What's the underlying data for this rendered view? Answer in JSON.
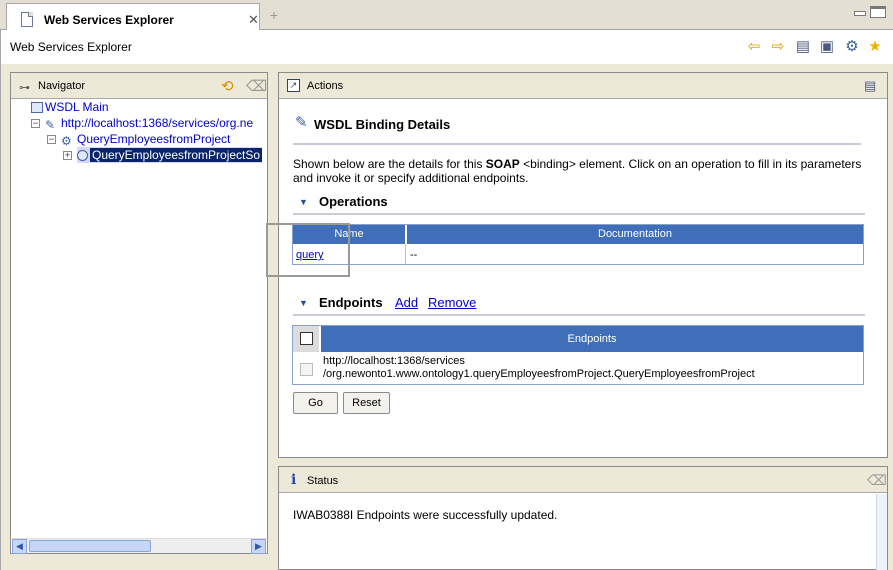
{
  "tab": {
    "title": "Web Services Explorer",
    "close": "✕"
  },
  "toolbar": {
    "title": "Web Services Explorer",
    "icons": [
      "back-icon",
      "forward-icon",
      "history-icon",
      "favorites-page-icon",
      "wsdl-icon",
      "favorites-star-icon"
    ]
  },
  "navigator": {
    "title": "Navigator",
    "tree": [
      {
        "label": "WSDL Main"
      },
      {
        "label": "http://localhost:1368/services/org.ne"
      },
      {
        "label": "QueryEmployeesfromProject"
      },
      {
        "label": "QueryEmployeesfromProjectSo"
      }
    ]
  },
  "actions": {
    "title": "Actions",
    "heading": "WSDL Binding Details",
    "description_line1_pre": "Shown below are the details for this ",
    "description_bold": "SOAP",
    "description_line1_post": " <binding> element. Click on an operation to fill in its parameters",
    "description_line2": "and invoke it or specify additional endpoints.",
    "operations": {
      "title": "Operations",
      "col_name": "Name",
      "col_doc": "Documentation",
      "rows": [
        {
          "name": "query",
          "doc": "--"
        }
      ]
    },
    "endpoints": {
      "title": "Endpoints",
      "add": "Add",
      "remove": "Remove",
      "col": "Endpoints",
      "rows": [
        {
          "line1": "http://localhost:1368/services",
          "line2": "/org.newonto1.www.ontology1.queryEmployeesfromProject.QueryEmployeesfromProject"
        }
      ]
    },
    "go_label": "Go",
    "reset_label": "Reset"
  },
  "status": {
    "title": "Status",
    "message": "IWAB0388I Endpoints were successfully updated."
  },
  "colors": {
    "table_header": "#3e6fb8",
    "link": "#0000cc",
    "chrome": "#ece9d8"
  }
}
